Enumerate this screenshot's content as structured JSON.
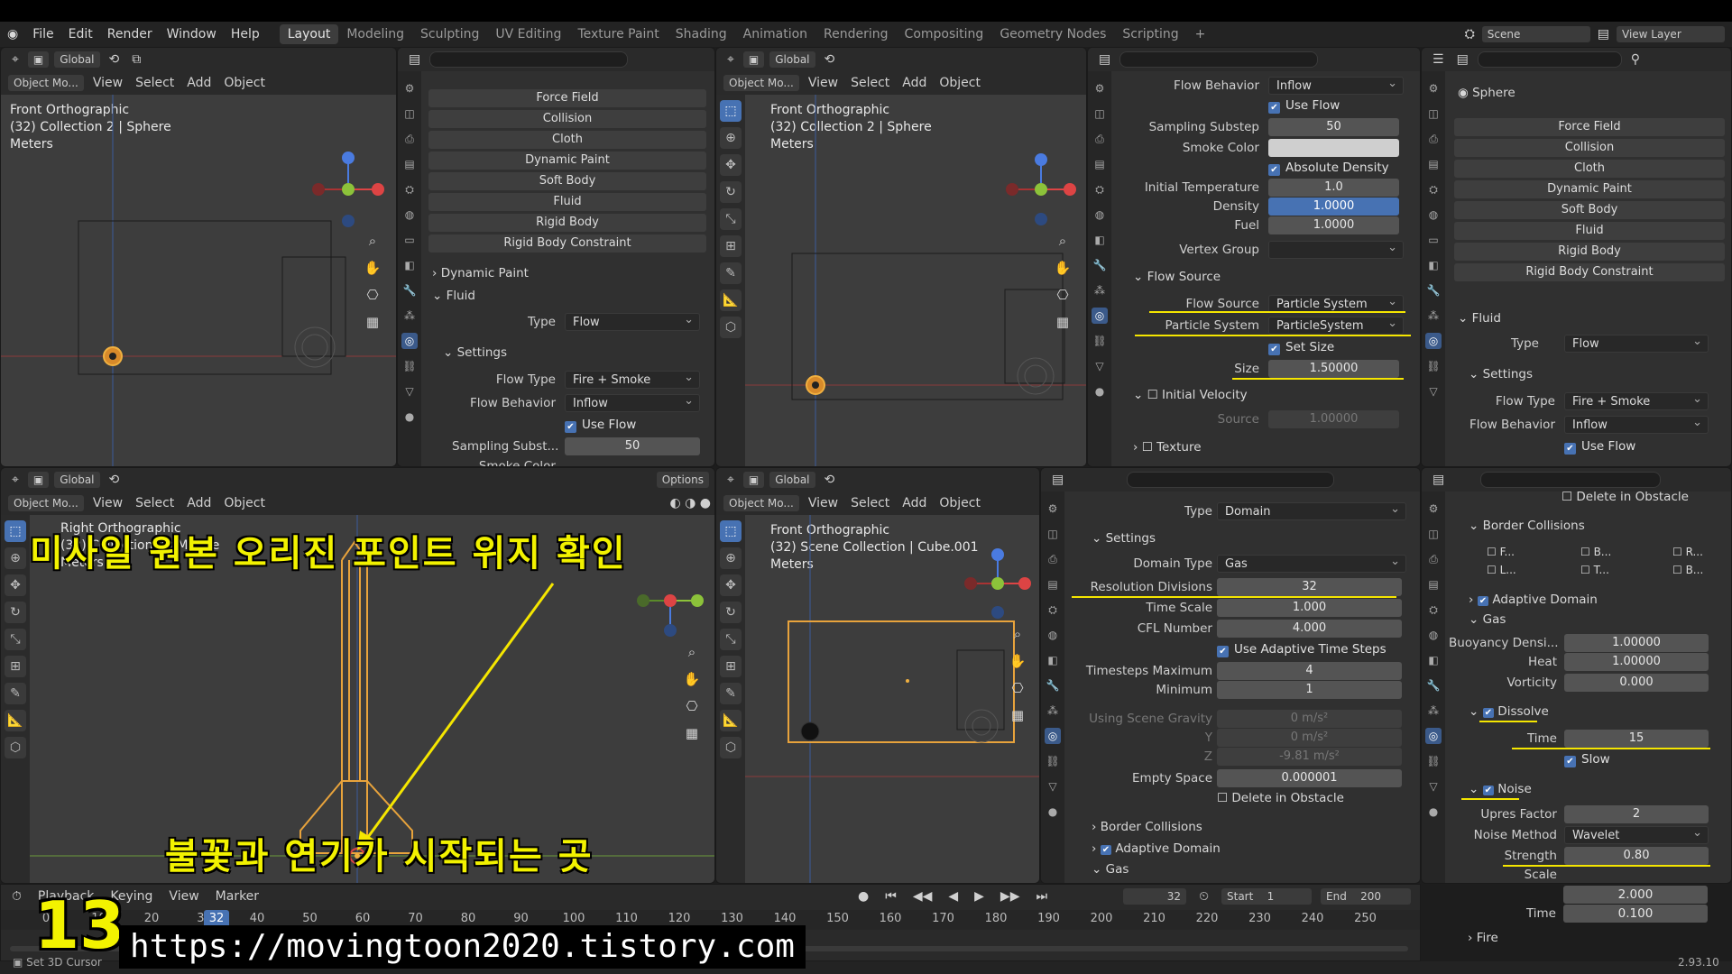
{
  "menu": {
    "logo": "blender-logo",
    "items": [
      "File",
      "Edit",
      "Render",
      "Window",
      "Help"
    ],
    "workspaces": [
      "Layout",
      "Modeling",
      "Sculpting",
      "UV Editing",
      "Texture Paint",
      "Shading",
      "Animation",
      "Rendering",
      "Compositing",
      "Geometry Nodes",
      "Scripting"
    ],
    "plus": "+",
    "scene_label": "Scene",
    "view_layer_label": "View Layer"
  },
  "header": {
    "global": "Global",
    "mode": "Object Mo...",
    "view": "View",
    "select": "Select",
    "add": "Add",
    "object": "Object",
    "options": "Options"
  },
  "viewport_tl": {
    "line1": "Front Orthographic",
    "line2": "(32) Collection 2 | Sphere",
    "line3": "Meters"
  },
  "viewport_tr": {
    "line1": "Front Orthographic",
    "line2": "(32) Collection 2 | Sphere",
    "line3": "Meters"
  },
  "viewport_bl": {
    "line1": "Right Orthographic",
    "line2": "(32) Collection 2 | Missile",
    "line3": "Meters"
  },
  "viewport_br": {
    "line1": "Front Orthographic",
    "line2": "(32) Scene Collection | Cube.001",
    "line3": "Meters"
  },
  "props_tl": {
    "physics_buttons": [
      "Force Field",
      "Collision",
      "Cloth",
      "Dynamic Paint",
      "Soft Body",
      "Fluid",
      "Rigid Body",
      "Rigid Body Constraint"
    ],
    "sec_dynamic_paint": "Dynamic Paint",
    "sec_fluid": "Fluid",
    "type_label": "Type",
    "type_value": "Flow",
    "sec_settings": "Settings",
    "flow_type_label": "Flow Type",
    "flow_type_value": "Fire + Smoke",
    "flow_behavior_label": "Flow Behavior",
    "flow_behavior_value": "Inflow",
    "use_flow": "Use Flow",
    "sampling_label": "Sampling Subst...",
    "sampling_value": "50",
    "smoke_color_label": "Smoke Color"
  },
  "props_tr": {
    "flow_behavior_label": "Flow Behavior",
    "flow_behavior_value": "Inflow",
    "use_flow": "Use Flow",
    "sampling_label": "Sampling Substep",
    "sampling_value": "50",
    "smoke_color_label": "Smoke Color",
    "absolute_density": "Absolute Density",
    "init_temp_label": "Initial Temperature",
    "init_temp_value": "1.0",
    "density_label": "Density",
    "density_value": "1.0000",
    "fuel_label": "Fuel",
    "fuel_value": "1.0000",
    "vertex_group_label": "Vertex Group",
    "sec_flow_source": "Flow Source",
    "flow_source_label": "Flow Source",
    "flow_source_value": "Particle System",
    "particle_system_label": "Particle System",
    "particle_system_value": "ParticleSystem",
    "set_size": "Set Size",
    "size_label": "Size",
    "size_value": "1.50000",
    "sec_initial_velocity": "Initial Velocity",
    "source_label": "Source",
    "source_value": "1.00000",
    "sec_texture": "Texture"
  },
  "props_br": {
    "type_label": "Type",
    "type_value": "Domain",
    "sec_settings": "Settings",
    "domain_type_label": "Domain Type",
    "domain_type_value": "Gas",
    "res_label": "Resolution Divisions",
    "res_value": "32",
    "time_scale_label": "Time Scale",
    "time_scale_value": "1.000",
    "cfl_label": "CFL Number",
    "cfl_value": "4.000",
    "adaptive_steps": "Use Adaptive Time Steps",
    "ts_max_label": "Timesteps Maximum",
    "ts_max_value": "4",
    "ts_min_label": "Minimum",
    "ts_min_value": "1",
    "gravity_label": "Using Scene Gravity",
    "gravity_x": "0 m/s²",
    "y_label": "Y",
    "gravity_y": "0 m/s²",
    "z_label": "Z",
    "gravity_z": "-9.81 m/s²",
    "empty_space_label": "Empty Space",
    "empty_space_value": "0.000001",
    "delete_in_obstacle": "Delete in Obstacle",
    "sec_border": "Border Collisions",
    "sec_adaptive": "Adaptive Domain",
    "sec_gas": "Gas"
  },
  "outliner_tr": {
    "object_name": "Sphere",
    "physics_buttons": [
      "Force Field",
      "Collision",
      "Cloth",
      "Dynamic Paint",
      "Soft Body",
      "Fluid",
      "Rigid Body",
      "Rigid Body Constraint"
    ],
    "sec_fluid": "Fluid",
    "type_label": "Type",
    "type_value": "Flow",
    "sec_settings": "Settings",
    "flow_type_label": "Flow Type",
    "flow_type_value": "Fire + Smoke",
    "flow_behavior_label": "Flow Behavior",
    "flow_behavior_value": "Inflow",
    "use_flow": "Use Flow"
  },
  "props_rb": {
    "delete_in_obstacle": "Delete in Obstacle",
    "sec_border": "Border Collisions",
    "border_items": [
      "F...",
      "B...",
      "R...",
      "L...",
      "T...",
      "B..."
    ],
    "sec_adaptive": "Adaptive Domain",
    "sec_gas": "Gas",
    "buoyancy_label": "Buoyancy Densi...",
    "buoyancy_value": "1.00000",
    "heat_label": "Heat",
    "heat_value": "1.00000",
    "vorticity_label": "Vorticity",
    "vorticity_value": "0.000",
    "sec_dissolve": "Dissolve",
    "time_label": "Time",
    "time_value": "15",
    "slow": "Slow",
    "sec_noise": "Noise",
    "upres_label": "Upres Factor",
    "upres_value": "2",
    "noise_method_label": "Noise Method",
    "noise_method_value": "Wavelet",
    "strength_label": "Strength",
    "strength_value": "0.80",
    "scale_label": "Scale",
    "scale_value": "2.000",
    "noise_time_label": "Time",
    "noise_time_value": "0.100",
    "sec_fire": "Fire"
  },
  "timeline": {
    "playback": "Playback",
    "keying": "Keying",
    "view": "View",
    "marker": "Marker",
    "current_frame": "32",
    "start_label": "Start",
    "start_value": "1",
    "end_label": "End",
    "end_value": "200",
    "ticks": [
      "0",
      "10",
      "20",
      "30",
      "40",
      "50",
      "60",
      "70",
      "80",
      "90",
      "100",
      "110",
      "120",
      "130",
      "140",
      "150",
      "160",
      "170",
      "180",
      "190",
      "200",
      "210",
      "220",
      "230",
      "240",
      "250"
    ],
    "status": "Set 3D Cursor",
    "version": "2.93.10"
  },
  "overlay": {
    "caption_top": "미사일 원본 오리진 포인트 위지 확인",
    "caption_bottom": "불꽃과 연기가 시작되는 곳",
    "episode_number": "13",
    "url": "https://movingtoon2020.tistory.com"
  },
  "colors": {
    "accent": "#4772b3",
    "highlight": "#f5e600",
    "selection": "#e8a33c"
  }
}
